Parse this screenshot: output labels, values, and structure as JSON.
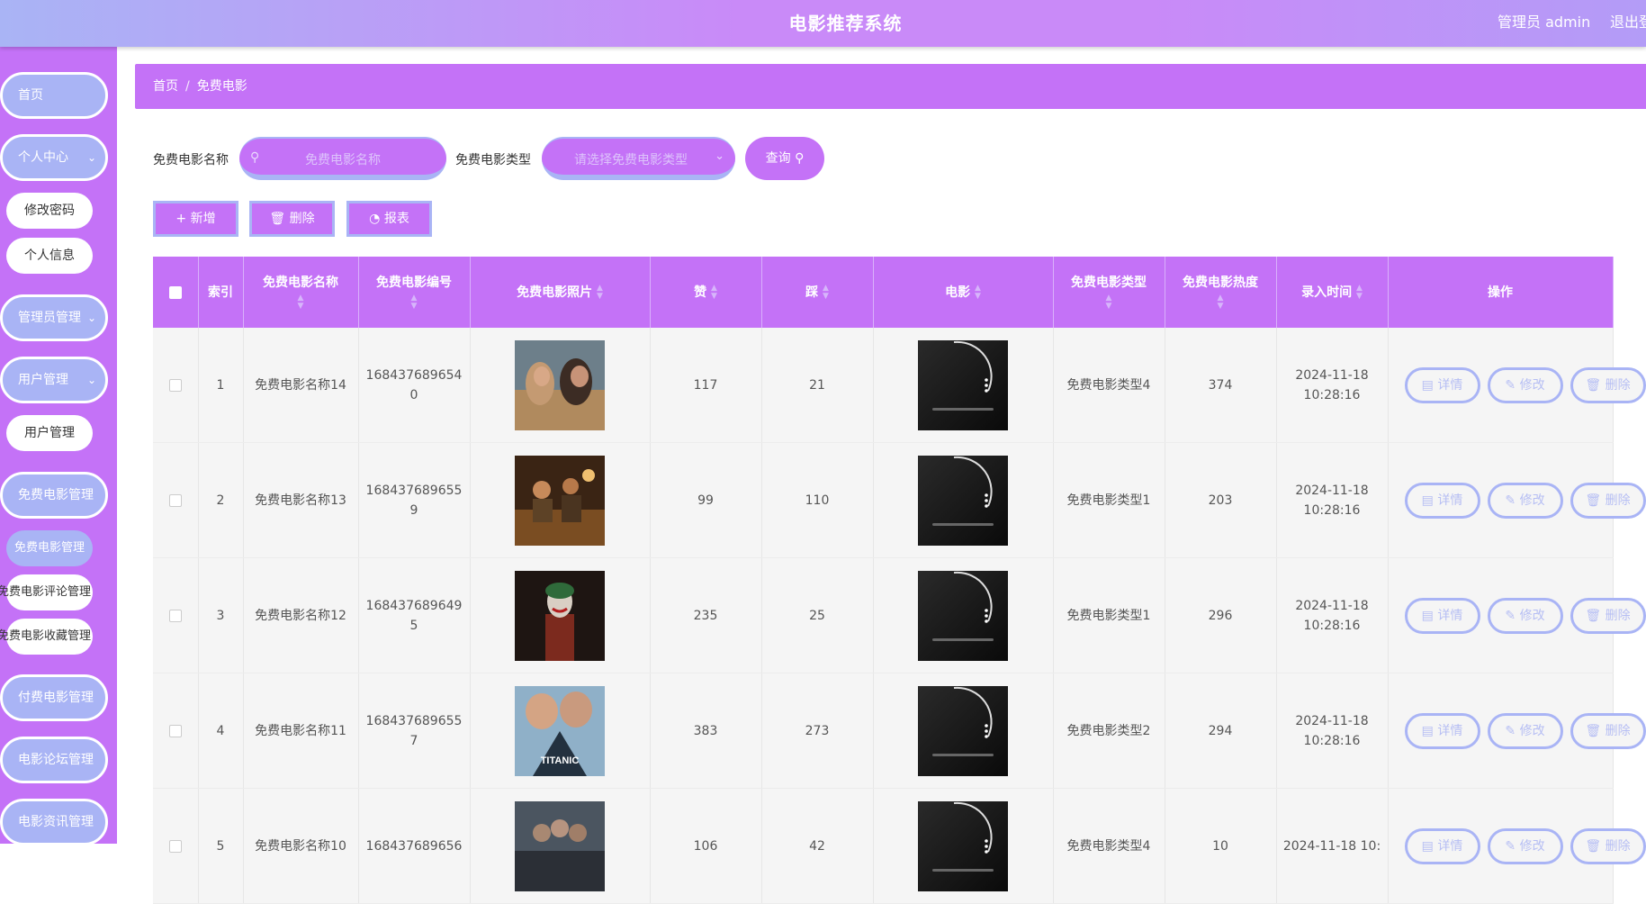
{
  "header": {
    "title": "电影推荐系统",
    "user": "管理员 admin",
    "logout": "退出登录"
  },
  "sidebar": {
    "home": "首页",
    "personal": "个人中心",
    "change_password": "修改密码",
    "profile": "个人信息",
    "admin_mgmt": "管理员管理",
    "user_mgmt": "用户管理",
    "user_mgmt_sub": "用户管理",
    "free_movie_mgmt": "免费电影管理",
    "free_movie_mgmt_sub": "免费电影管理",
    "free_movie_comment": "免费电影评论管理",
    "free_movie_fav": "免费电影收藏管理",
    "paid_movie_mgmt": "付费电影管理",
    "forum_mgmt": "电影论坛管理",
    "news_mgmt": "电影资讯管理"
  },
  "breadcrumb": {
    "home": "首页",
    "sep": "/",
    "current": "免费电影"
  },
  "search": {
    "name_label": "免费电影名称",
    "name_placeholder": "免费电影名称",
    "type_label": "免费电影类型",
    "type_placeholder": "请选择免费电影类型",
    "query_button": "查询"
  },
  "actions": {
    "add": "新增",
    "delete": "删除",
    "report": "报表"
  },
  "table": {
    "columns": {
      "index": "索引",
      "name": "免费电影名称",
      "code": "免费电影编号",
      "poster": "免费电影照片",
      "likes": "赞",
      "dislikes": "踩",
      "movie": "电影",
      "type": "免费电影类型",
      "heat": "免费电影热度",
      "time": "录入时间",
      "ops": "操作"
    },
    "op_labels": {
      "detail": "详情",
      "edit": "修改",
      "delete": "删除"
    },
    "rows": [
      {
        "index": "1",
        "name": "免费电影名称14",
        "code": "1684376896540",
        "likes": "117",
        "dislikes": "21",
        "type": "免费电影类型4",
        "heat": "374",
        "time": "2024-11-18 10:28:16"
      },
      {
        "index": "2",
        "name": "免费电影名称13",
        "code": "1684376896559",
        "likes": "99",
        "dislikes": "110",
        "type": "免费电影类型1",
        "heat": "203",
        "time": "2024-11-18 10:28:16"
      },
      {
        "index": "3",
        "name": "免费电影名称12",
        "code": "1684376896495",
        "likes": "235",
        "dislikes": "25",
        "type": "免费电影类型1",
        "heat": "296",
        "time": "2024-11-18 10:28:16"
      },
      {
        "index": "4",
        "name": "免费电影名称11",
        "code": "1684376896557",
        "likes": "383",
        "dislikes": "273",
        "type": "免费电影类型2",
        "heat": "294",
        "time": "2024-11-18 10:28:16"
      },
      {
        "index": "5",
        "name": "免费电影名称10",
        "code": "168437689656",
        "likes": "106",
        "dislikes": "42",
        "type": "免费电影类型4",
        "heat": "10",
        "time": "2024-11-18 10:"
      }
    ]
  },
  "colors": {
    "primary": "#c472f7",
    "secondary": "#a9b4f5"
  }
}
